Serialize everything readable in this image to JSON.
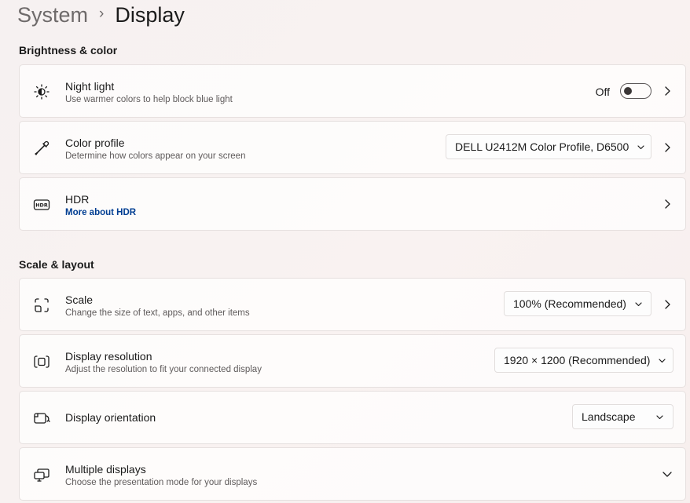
{
  "breadcrumb": {
    "parent": "System",
    "separator": "›",
    "current": "Display"
  },
  "sections": {
    "brightness": "Brightness & color",
    "scale": "Scale & layout"
  },
  "night_light": {
    "title": "Night light",
    "subtitle": "Use warmer colors to help block blue light",
    "state": "Off",
    "icon": "sun-moon-icon"
  },
  "color_profile": {
    "title": "Color profile",
    "subtitle": "Determine how colors appear on your screen",
    "value": "DELL U2412M Color Profile, D6500",
    "icon": "eyedropper-icon"
  },
  "hdr": {
    "title": "HDR",
    "link": "More about HDR",
    "icon": "hdr-icon"
  },
  "scale": {
    "title": "Scale",
    "subtitle": "Change the size of text, apps, and other items",
    "value": "100% (Recommended)",
    "icon": "scale-icon"
  },
  "resolution": {
    "title": "Display resolution",
    "subtitle": "Adjust the resolution to fit your connected display",
    "value": "1920 × 1200 (Recommended)",
    "icon": "resolution-icon"
  },
  "orientation": {
    "title": "Display orientation",
    "value": "Landscape",
    "icon": "orientation-icon"
  },
  "multiple_displays": {
    "title": "Multiple displays",
    "subtitle": "Choose the presentation mode for your displays",
    "icon": "multiple-displays-icon"
  },
  "colors": {
    "link": "#003e92",
    "text": "#1b1b1b",
    "secondary_text": "#5f5b5b"
  }
}
